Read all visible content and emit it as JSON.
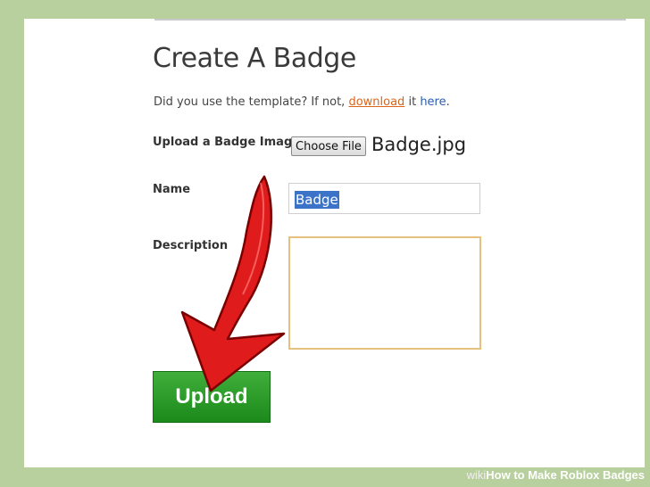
{
  "page": {
    "title": "Create A Badge",
    "template_prefix": "Did you use the template? If not, ",
    "template_link": "download",
    "template_mid": " it ",
    "template_here": "here",
    "template_end": "."
  },
  "form": {
    "upload_label": "Upload a Badge Image",
    "choose_file_label": "Choose File",
    "file_name": "Badge.jpg",
    "name_label": "Name",
    "name_value": "Badge",
    "description_label": "Description",
    "description_value": "",
    "upload_button": "Upload"
  },
  "colors": {
    "upload_green": "#2e9e2b",
    "arrow_red": "#e01b1b",
    "link_orange": "#d9651a",
    "selection_blue": "#3b73c9"
  },
  "watermark": {
    "brand": "wiki",
    "text": "How to Make Roblox Badges"
  }
}
